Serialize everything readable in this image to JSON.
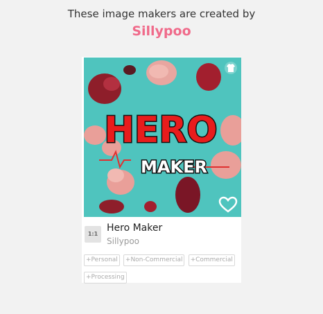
{
  "header": {
    "intro": "These image makers are created by",
    "creator": "Sillypoo"
  },
  "card": {
    "image_text_line1": "HERO",
    "image_text_line2": "MAKER",
    "ratio_label": "1:1",
    "title": "Hero Maker",
    "author": "Sillypoo",
    "tags": [
      "+Personal",
      "+Non-Commercial",
      "+Commercial",
      "+Processing"
    ],
    "icons": {
      "top_right": "tshirt-icon",
      "bottom_right": "heart-icon"
    },
    "colors": {
      "accent": "#f06a8a",
      "image_background": "#4fc4be"
    }
  }
}
